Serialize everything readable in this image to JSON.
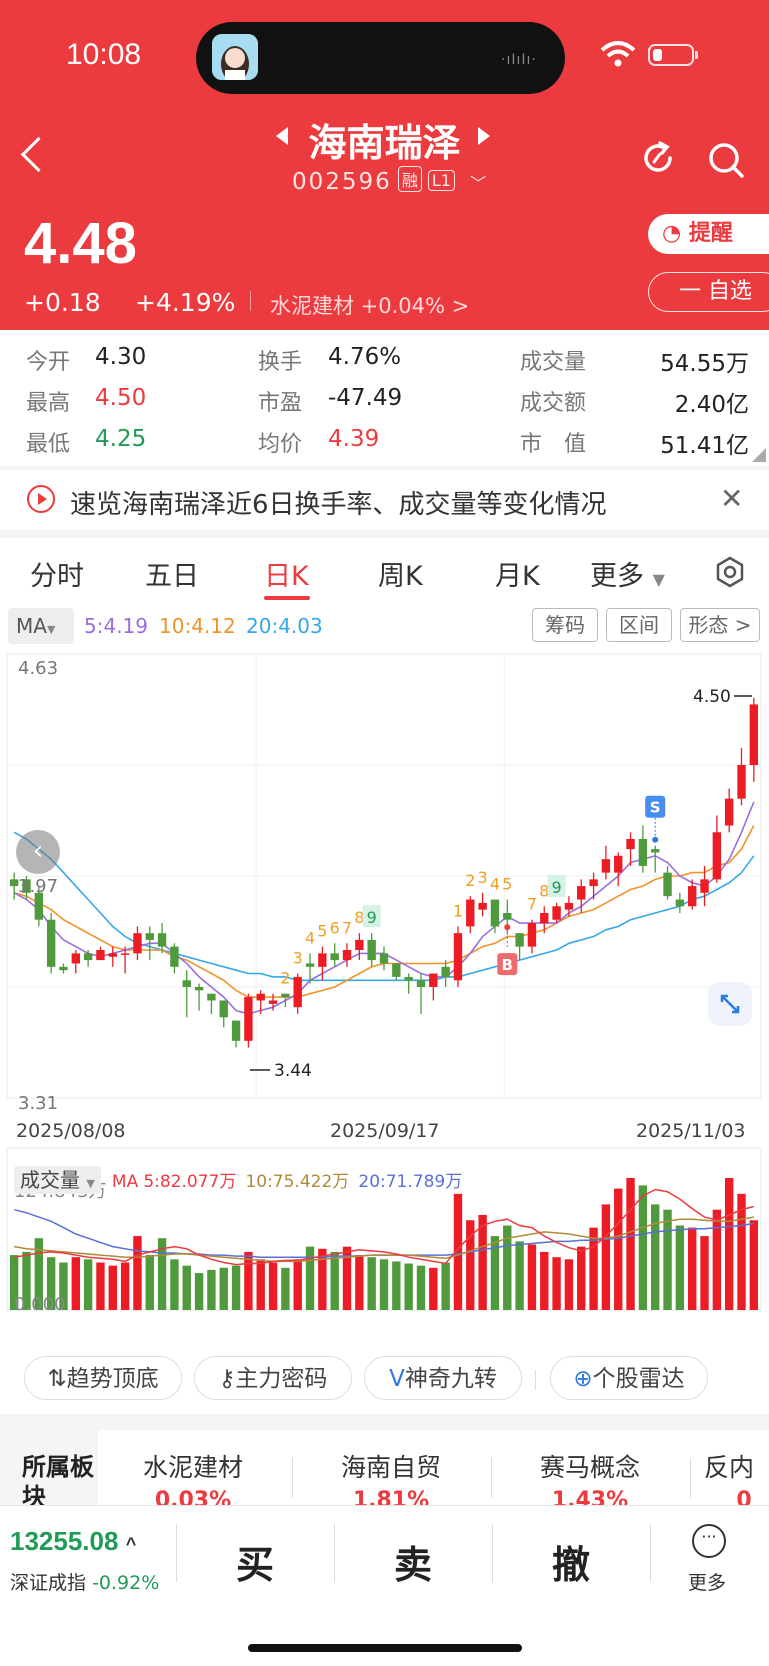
{
  "status_bar": {
    "time": "10:08"
  },
  "header": {
    "stock_name": "海南瑞泽",
    "stock_code": "002596",
    "tag_margin": "融",
    "tag_level": "L1",
    "price": "4.48",
    "change": "+0.18",
    "change_pct": "+4.19%",
    "sector": "水泥建材 +0.04% >",
    "alert_label": "提醒",
    "watch_label": "一 自选",
    "colors": {
      "bg": "#ec3b3f"
    }
  },
  "stats": {
    "open_label": "今开",
    "open": "4.30",
    "high_label": "最高",
    "high": "4.50",
    "low_label": "最低",
    "low": "4.25",
    "turnover_label": "换手",
    "turnover": "4.76%",
    "pe_label": "市盈",
    "pe": "-47.49",
    "avg_label": "均价",
    "avg": "4.39",
    "volume_label": "成交量",
    "volume": "54.55万",
    "amount_label": "成交额",
    "amount": "2.40亿",
    "mktcap_label": "市　值",
    "mktcap": "51.41亿"
  },
  "banner": {
    "text": "速览海南瑞泽近6日换手率、成交量等变化情况"
  },
  "tabs": [
    "分时",
    "五日",
    "日K",
    "周K",
    "月K",
    "更多"
  ],
  "active_tab": "日K",
  "chart_controls": {
    "ma_button": "MA",
    "ma5": "5:4.19",
    "ma10": "10:4.12",
    "ma20": "20:4.03",
    "chip1": "筹码",
    "chip2": "区间",
    "chip3": "形态 >"
  },
  "chart_data": {
    "type": "candlestick",
    "y_max_label": "4.63",
    "y_mid_label": "3.97",
    "y_min_label": "3.31",
    "ylim": [
      3.31,
      4.63
    ],
    "high_mark": "4.50",
    "low_mark": "3.44",
    "x_labels": [
      "2025/08/08",
      "2025/09/17",
      "2025/11/03"
    ],
    "candles": [
      [
        3.96,
        3.98,
        3.9,
        3.94
      ],
      [
        3.96,
        3.97,
        3.9,
        3.92
      ],
      [
        3.92,
        3.94,
        3.82,
        3.84
      ],
      [
        3.84,
        3.86,
        3.68,
        3.7
      ],
      [
        3.7,
        3.71,
        3.68,
        3.69
      ],
      [
        3.71,
        3.75,
        3.68,
        3.74
      ],
      [
        3.74,
        3.75,
        3.7,
        3.72
      ],
      [
        3.72,
        3.76,
        3.72,
        3.75
      ],
      [
        3.73,
        3.76,
        3.7,
        3.74
      ],
      [
        3.74,
        3.76,
        3.68,
        3.74
      ],
      [
        3.74,
        3.82,
        3.72,
        3.8
      ],
      [
        3.8,
        3.82,
        3.72,
        3.78
      ],
      [
        3.8,
        3.83,
        3.74,
        3.76
      ],
      [
        3.76,
        3.77,
        3.68,
        3.7
      ],
      [
        3.66,
        3.69,
        3.55,
        3.64
      ],
      [
        3.64,
        3.65,
        3.57,
        3.63
      ],
      [
        3.62,
        3.62,
        3.56,
        3.6
      ],
      [
        3.6,
        3.6,
        3.52,
        3.55
      ],
      [
        3.54,
        3.54,
        3.46,
        3.48
      ],
      [
        3.48,
        3.62,
        3.46,
        3.61
      ],
      [
        3.6,
        3.63,
        3.56,
        3.62
      ],
      [
        3.59,
        3.62,
        3.57,
        3.6
      ],
      [
        3.62,
        3.62,
        3.58,
        3.61
      ],
      [
        3.58,
        3.68,
        3.56,
        3.67
      ],
      [
        3.71,
        3.74,
        3.65,
        3.7
      ],
      [
        3.7,
        3.76,
        3.66,
        3.74
      ],
      [
        3.74,
        3.77,
        3.7,
        3.72
      ],
      [
        3.72,
        3.77,
        3.7,
        3.75
      ],
      [
        3.75,
        3.8,
        3.72,
        3.78
      ],
      [
        3.78,
        3.8,
        3.7,
        3.72
      ],
      [
        3.74,
        3.76,
        3.69,
        3.71
      ],
      [
        3.71,
        3.71,
        3.66,
        3.67
      ],
      [
        3.67,
        3.68,
        3.62,
        3.66
      ],
      [
        3.66,
        3.68,
        3.56,
        3.64
      ],
      [
        3.64,
        3.68,
        3.6,
        3.68
      ],
      [
        3.7,
        3.72,
        3.64,
        3.67
      ],
      [
        3.66,
        3.82,
        3.64,
        3.8
      ],
      [
        3.82,
        3.91,
        3.8,
        3.9
      ],
      [
        3.87,
        3.92,
        3.85,
        3.89
      ],
      [
        3.9,
        3.9,
        3.8,
        3.82
      ],
      [
        3.86,
        3.9,
        3.8,
        3.84
      ],
      [
        3.8,
        3.8,
        3.72,
        3.76
      ],
      [
        3.76,
        3.84,
        3.74,
        3.83
      ],
      [
        3.83,
        3.88,
        3.8,
        3.86
      ],
      [
        3.84,
        3.89,
        3.83,
        3.88
      ],
      [
        3.87,
        3.91,
        3.85,
        3.89
      ],
      [
        3.9,
        3.96,
        3.86,
        3.94
      ],
      [
        3.94,
        3.98,
        3.9,
        3.96
      ],
      [
        3.98,
        4.06,
        3.96,
        4.02
      ],
      [
        3.98,
        4.04,
        3.94,
        4.03
      ],
      [
        4.05,
        4.1,
        4.0,
        4.08
      ],
      [
        4.08,
        4.12,
        3.98,
        4.0
      ],
      [
        4.05,
        4.06,
        3.98,
        4.04
      ],
      [
        3.98,
        4.0,
        3.9,
        3.91
      ],
      [
        3.9,
        3.92,
        3.86,
        3.88
      ],
      [
        3.88,
        3.96,
        3.87,
        3.94
      ],
      [
        3.92,
        4.0,
        3.88,
        3.96
      ],
      [
        3.96,
        4.15,
        3.95,
        4.1
      ],
      [
        4.12,
        4.23,
        4.1,
        4.2
      ],
      [
        4.2,
        4.35,
        4.18,
        4.3
      ],
      [
        4.3,
        4.5,
        4.25,
        4.48
      ]
    ],
    "ma5": [
      3.92,
      3.9,
      3.87,
      3.82,
      3.78,
      3.76,
      3.74,
      3.73,
      3.74,
      3.75,
      3.76,
      3.77,
      3.77,
      3.74,
      3.71,
      3.67,
      3.64,
      3.61,
      3.57,
      3.56,
      3.57,
      3.58,
      3.6,
      3.62,
      3.66,
      3.68,
      3.7,
      3.72,
      3.74,
      3.74,
      3.74,
      3.72,
      3.7,
      3.68,
      3.67,
      3.67,
      3.7,
      3.74,
      3.79,
      3.82,
      3.85,
      3.83,
      3.83,
      3.83,
      3.83,
      3.86,
      3.88,
      3.91,
      3.94,
      3.97,
      4.01,
      4.02,
      4.03,
      4.01,
      3.97,
      3.95,
      3.94,
      3.97,
      4.02,
      4.1,
      4.19
    ],
    "ma10": [
      3.92,
      3.91,
      3.89,
      3.87,
      3.84,
      3.82,
      3.8,
      3.78,
      3.76,
      3.75,
      3.75,
      3.75,
      3.75,
      3.73,
      3.72,
      3.7,
      3.68,
      3.66,
      3.63,
      3.61,
      3.61,
      3.61,
      3.61,
      3.61,
      3.62,
      3.63,
      3.64,
      3.66,
      3.68,
      3.7,
      3.71,
      3.71,
      3.71,
      3.71,
      3.71,
      3.71,
      3.72,
      3.74,
      3.76,
      3.77,
      3.79,
      3.79,
      3.8,
      3.81,
      3.83,
      3.85,
      3.86,
      3.87,
      3.89,
      3.91,
      3.93,
      3.94,
      3.96,
      3.97,
      3.97,
      3.98,
      3.98,
      4.0,
      4.01,
      4.05,
      4.12
    ],
    "ma20": [
      4.1,
      4.08,
      4.05,
      4.02,
      3.98,
      3.94,
      3.9,
      3.86,
      3.82,
      3.79,
      3.77,
      3.76,
      3.75,
      3.74,
      3.73,
      3.72,
      3.71,
      3.7,
      3.69,
      3.68,
      3.68,
      3.67,
      3.67,
      3.66,
      3.66,
      3.66,
      3.66,
      3.66,
      3.66,
      3.66,
      3.66,
      3.66,
      3.66,
      3.66,
      3.66,
      3.67,
      3.67,
      3.68,
      3.69,
      3.7,
      3.71,
      3.72,
      3.73,
      3.74,
      3.75,
      3.77,
      3.78,
      3.79,
      3.81,
      3.82,
      3.84,
      3.85,
      3.86,
      3.87,
      3.88,
      3.9,
      3.91,
      3.93,
      3.95,
      3.98,
      4.03
    ],
    "td_counts": [
      {
        "i": 22,
        "n": "2"
      },
      {
        "i": 23,
        "n": "3"
      },
      {
        "i": 24,
        "n": "4"
      },
      {
        "i": 25,
        "n": "5"
      },
      {
        "i": 26,
        "n": "6"
      },
      {
        "i": 27,
        "n": "7"
      },
      {
        "i": 28,
        "n": "8"
      },
      {
        "i": 29,
        "n": "9",
        "g": true
      },
      {
        "i": 36,
        "n": "1"
      },
      {
        "i": 37,
        "n": "2"
      },
      {
        "i": 38,
        "n": "3"
      },
      {
        "i": 39,
        "n": "4"
      },
      {
        "i": 40,
        "n": "5"
      },
      {
        "i": 42,
        "n": "7"
      },
      {
        "i": 43,
        "n": "8"
      },
      {
        "i": 44,
        "n": "9",
        "g": true
      }
    ],
    "buy_marker": {
      "i": 40,
      "label": "B"
    },
    "sell_marker": {
      "i": 52,
      "label": "S"
    },
    "volume": {
      "label": "成交量",
      "max_label": "124.843万",
      "min_label": "0.000",
      "ma_label": "MA",
      "ma5": "5:82.077万",
      "ma10": "10:75.422万",
      "ma20": "20:71.789万",
      "values": [
        52,
        55,
        68,
        50,
        45,
        50,
        48,
        45,
        42,
        45,
        70,
        52,
        68,
        48,
        42,
        35,
        38,
        40,
        42,
        55,
        48,
        45,
        40,
        48,
        60,
        58,
        55,
        60,
        52,
        50,
        48,
        46,
        44,
        42,
        40,
        45,
        110,
        85,
        90,
        70,
        80,
        65,
        62,
        55,
        50,
        48,
        60,
        78,
        100,
        115,
        125,
        118,
        100,
        95,
        80,
        78,
        70,
        95,
        125,
        110,
        85
      ],
      "vma5": [
        50,
        52,
        54,
        55,
        54,
        52,
        50,
        49,
        48,
        46,
        52,
        55,
        58,
        60,
        58,
        52,
        48,
        45,
        43,
        44,
        44,
        46,
        47,
        47,
        49,
        51,
        53,
        55,
        57,
        56,
        55,
        53,
        50,
        48,
        46,
        44,
        58,
        70,
        80,
        84,
        86,
        80,
        78,
        70,
        64,
        59,
        56,
        60,
        70,
        82,
        95,
        108,
        114,
        112,
        105,
        96,
        88,
        85,
        90,
        95,
        98
      ],
      "vma10": [
        60,
        58,
        57,
        56,
        55,
        54,
        53,
        52,
        51,
        50,
        50,
        51,
        52,
        53,
        53,
        52,
        51,
        50,
        49,
        48,
        47,
        46,
        46,
        46,
        47,
        48,
        49,
        50,
        51,
        52,
        52,
        52,
        52,
        51,
        50,
        49,
        52,
        56,
        60,
        64,
        68,
        70,
        72,
        74,
        73,
        72,
        70,
        68,
        68,
        70,
        74,
        78,
        82,
        84,
        86,
        86,
        85,
        84,
        84,
        86,
        88
      ],
      "vma20": [
        95,
        92,
        88,
        84,
        78,
        72,
        68,
        64,
        60,
        58,
        56,
        55,
        54,
        54,
        53,
        53,
        52,
        52,
        51,
        51,
        50,
        50,
        50,
        50,
        50,
        50,
        51,
        51,
        51,
        52,
        52,
        52,
        52,
        52,
        52,
        52,
        53,
        55,
        57,
        59,
        61,
        62,
        63,
        64,
        65,
        65,
        66,
        66,
        67,
        68,
        70,
        72,
        74,
        75,
        76,
        77,
        77,
        78,
        79,
        80,
        82
      ]
    }
  },
  "tools": [
    "趋势顶底",
    "主力密码",
    "神奇九转",
    "个股雷达"
  ],
  "sectors": {
    "label": "所属板块",
    "items": [
      {
        "name": "水泥建材",
        "pct": "0.03%"
      },
      {
        "name": "海南自贸",
        "pct": "1.81%"
      },
      {
        "name": "赛马概念",
        "pct": "1.43%"
      },
      {
        "name": "反内",
        "pct": "0"
      }
    ]
  },
  "bottom": {
    "index_value": "13255.08",
    "index_name": "深证成指",
    "index_change": "-0.92%",
    "buy": "买",
    "sell": "卖",
    "cancel": "撤",
    "more": "更多"
  }
}
